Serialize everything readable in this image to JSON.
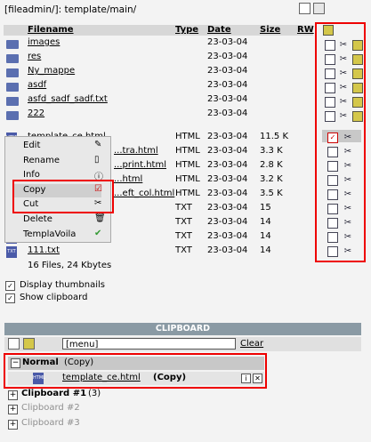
{
  "path": "[fileadmin/]: template/main/",
  "columns": {
    "filename": "Filename",
    "type": "Type",
    "date": "Date",
    "size": "Size",
    "rw": "RW"
  },
  "folders": [
    {
      "name": "images",
      "type": "",
      "date": "23-03-04",
      "size": ""
    },
    {
      "name": "res",
      "type": "",
      "date": "23-03-04",
      "size": ""
    },
    {
      "name": "Ny_mappe",
      "type": "",
      "date": "23-03-04",
      "size": ""
    },
    {
      "name": "asdf",
      "type": "",
      "date": "23-03-04",
      "size": ""
    },
    {
      "name": "asfd_sadf_sadf.txt",
      "type": "",
      "date": "23-03-04",
      "size": ""
    },
    {
      "name": "222",
      "type": "",
      "date": "23-03-04",
      "size": ""
    }
  ],
  "files": [
    {
      "name": "template_ce.html",
      "type": "HTML",
      "date": "23-03-04",
      "size": "11.5 K"
    },
    {
      "name": "...tra.html",
      "type": "HTML",
      "date": "23-03-04",
      "size": "3.3 K"
    },
    {
      "name": "...print.html",
      "type": "HTML",
      "date": "23-03-04",
      "size": "2.8 K"
    },
    {
      "name": "...html",
      "type": "HTML",
      "date": "23-03-04",
      "size": "3.2 K"
    },
    {
      "name": "...eft_col.html",
      "type": "HTML",
      "date": "23-03-04",
      "size": "3.5 K"
    },
    {
      "name": "",
      "type": "TXT",
      "date": "23-03-04",
      "size": "15"
    },
    {
      "name": "",
      "type": "TXT",
      "date": "23-03-04",
      "size": "14"
    },
    {
      "name": "",
      "type": "TXT",
      "date": "23-03-04",
      "size": "14"
    },
    {
      "name": "111.txt",
      "type": "TXT",
      "date": "23-03-04",
      "size": "14"
    }
  ],
  "summary": "16 Files, 24 Kbytes",
  "context_menu": {
    "edit": "Edit",
    "rename": "Rename",
    "info": "Info",
    "copy": "Copy",
    "cut": "Cut",
    "delete": "Delete",
    "templavoila": "TemplaVoila"
  },
  "options": {
    "thumbnails": "Display thumbnails",
    "clipboard": "Show clipboard"
  },
  "clipboard": {
    "title": "CLIPBOARD",
    "menu": "[menu]",
    "clear": "Clear",
    "normal_label": "Normal",
    "normal_mode": "(Copy)",
    "item_name": "template_ce.html",
    "item_mode": "(Copy)",
    "pad1_label": "Clipboard #1",
    "pad1_count": "(3)",
    "pad2_label": "Clipboard #2",
    "pad3_label": "Clipboard #3"
  },
  "colors": {
    "highlight_border": "#e00000",
    "clipboard_bar": "#8a9aa4"
  }
}
